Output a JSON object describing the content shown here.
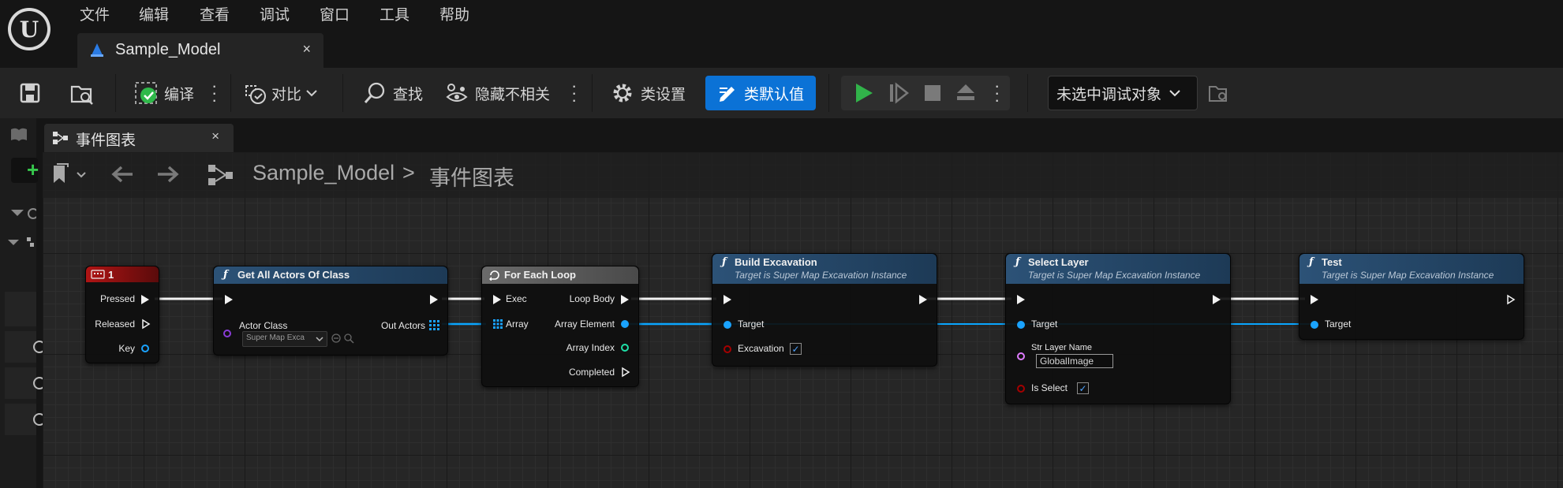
{
  "menu": [
    "文件",
    "编辑",
    "查看",
    "调试",
    "窗口",
    "工具",
    "帮助"
  ],
  "doc_tab": {
    "label": "Sample_Model",
    "close": "×"
  },
  "toolbar": {
    "compile_label": "编译",
    "diff_label": "对比",
    "find_label": "查找",
    "hide_unrelated_label": "隐藏不相关",
    "class_settings_label": "类设置",
    "class_defaults_label": "类默认值",
    "debug_target_label": "未选中调试对象"
  },
  "graph_tab": {
    "label": "事件图表",
    "close": "×"
  },
  "breadcrumb": {
    "root": "Sample_Model",
    "separator": ">",
    "current": "事件图表"
  },
  "nodes": {
    "key_event": {
      "title": "1",
      "pins": {
        "pressed": "Pressed",
        "released": "Released",
        "key": "Key"
      }
    },
    "get_all_actors": {
      "title": "Get All Actors Of Class",
      "actor_class_label": "Actor Class",
      "actor_class_value": "Super Map Exca",
      "out_actors": "Out Actors"
    },
    "for_each": {
      "title": "For Each Loop",
      "exec": "Exec",
      "array": "Array",
      "loop_body": "Loop Body",
      "array_element": "Array Element",
      "array_index": "Array Index",
      "completed": "Completed"
    },
    "build_excavation": {
      "title": "Build Excavation",
      "subtitle": "Target is Super Map Excavation Instance",
      "target": "Target",
      "excavation": "Excavation",
      "excavation_checked": true
    },
    "select_layer": {
      "title": "Select Layer",
      "subtitle": "Target is Super Map Excavation Instance",
      "target": "Target",
      "str_layer_name_label": "Str Layer Name",
      "str_layer_name_value": "GlobalImage",
      "is_select": "Is Select",
      "is_select_checked": true
    },
    "test": {
      "title": "Test",
      "subtitle": "Target is Super Map Excavation Instance",
      "target": "Target"
    }
  },
  "colors": {
    "accent": "#0b72d6",
    "exec_wire": "#f2f2f2",
    "object_wire": "#0aa6ff",
    "class_pin": "#8a3cd8",
    "bool_pin": "#a50000",
    "string_pin": "#e07cff",
    "int_pin": "#1fe0a8",
    "func_header": "#2c5277",
    "event_header": "#8b1010",
    "macro_header": "#5a5a5a"
  }
}
